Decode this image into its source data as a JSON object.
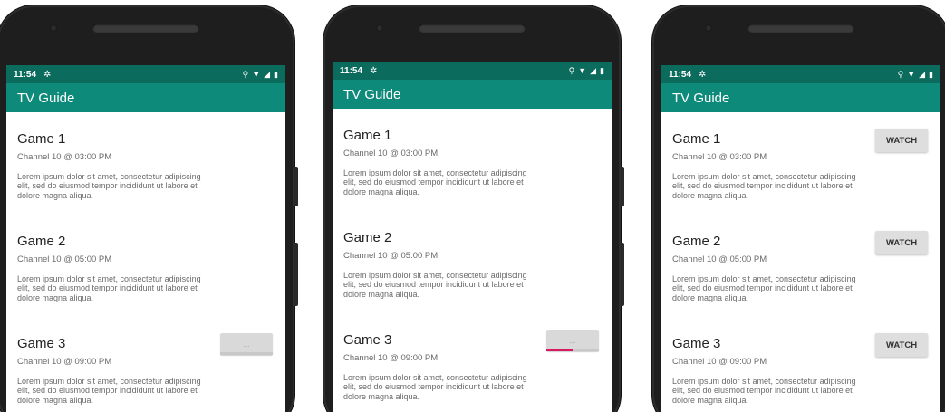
{
  "phones": [
    {
      "status": {
        "time": "11:54"
      },
      "appbar": {
        "title": "TV Guide"
      },
      "items": [
        {
          "title": "Game 1",
          "subtitle": "Channel 10 @ 03:00 PM",
          "description": "Lorem ipsum dolor sit amet, consectetur adipiscing elit, sed do eiusmod tempor incididunt ut labore et dolore magna aliqua."
        },
        {
          "title": "Game 2",
          "subtitle": "Channel 10 @ 05:00 PM",
          "description": "Lorem ipsum dolor sit amet, consectetur adipiscing elit, sed do eiusmod tempor incididunt ut labore et dolore magna aliqua."
        },
        {
          "title": "Game 3",
          "subtitle": "Channel 10 @ 09:00 PM",
          "description": "Lorem ipsum dolor sit amet, consectetur adipiscing elit, sed do eiusmod tempor incididunt ut labore et dolore magna aliqua.",
          "button": {
            "state": "loading",
            "label": "...",
            "progress": 0
          }
        }
      ]
    },
    {
      "status": {
        "time": "11:54"
      },
      "appbar": {
        "title": "TV Guide"
      },
      "items": [
        {
          "title": "Game 1",
          "subtitle": "Channel 10 @ 03:00 PM",
          "description": "Lorem ipsum dolor sit amet, consectetur adipiscing elit, sed do eiusmod tempor incididunt ut labore et dolore magna aliqua."
        },
        {
          "title": "Game 2",
          "subtitle": "Channel 10 @ 05:00 PM",
          "description": "Lorem ipsum dolor sit amet, consectetur adipiscing elit, sed do eiusmod tempor incididunt ut labore et dolore magna aliqua."
        },
        {
          "title": "Game 3",
          "subtitle": "Channel 10 @ 09:00 PM",
          "description": "Lorem ipsum dolor sit amet, consectetur adipiscing elit, sed do eiusmod tempor incididunt ut labore et dolore magna aliqua.",
          "button": {
            "state": "loading",
            "label": "...",
            "progress": 0.5
          }
        }
      ]
    },
    {
      "status": {
        "time": "11:54"
      },
      "appbar": {
        "title": "TV Guide"
      },
      "items": [
        {
          "title": "Game 1",
          "subtitle": "Channel 10 @ 03:00 PM",
          "description": "Lorem ipsum dolor sit amet, consectetur adipiscing elit, sed do eiusmod tempor incididunt ut labore et dolore magna aliqua.",
          "button": {
            "state": "ready",
            "label": "WATCH"
          }
        },
        {
          "title": "Game 2",
          "subtitle": "Channel 10 @ 05:00 PM",
          "description": "Lorem ipsum dolor sit amet, consectetur adipiscing elit, sed do eiusmod tempor incididunt ut labore et dolore magna aliqua.",
          "button": {
            "state": "ready",
            "label": "WATCH"
          }
        },
        {
          "title": "Game 3",
          "subtitle": "Channel 10 @ 09:00 PM",
          "description": "Lorem ipsum dolor sit amet, consectetur adipiscing elit, sed do eiusmod tempor incididunt ut labore et dolore magna aliqua.",
          "button": {
            "state": "ready",
            "label": "WATCH"
          }
        }
      ]
    }
  ],
  "icons": {
    "settings": "gear-icon",
    "location": "location-icon",
    "wifi": "wifi-icon",
    "signal": "signal-icon",
    "battery": "battery-icon"
  },
  "colors": {
    "status_bar": "#0b6b5d",
    "app_bar": "#0e8a7a",
    "progress_accent": "#d81b60",
    "button_bg": "#dedede"
  }
}
